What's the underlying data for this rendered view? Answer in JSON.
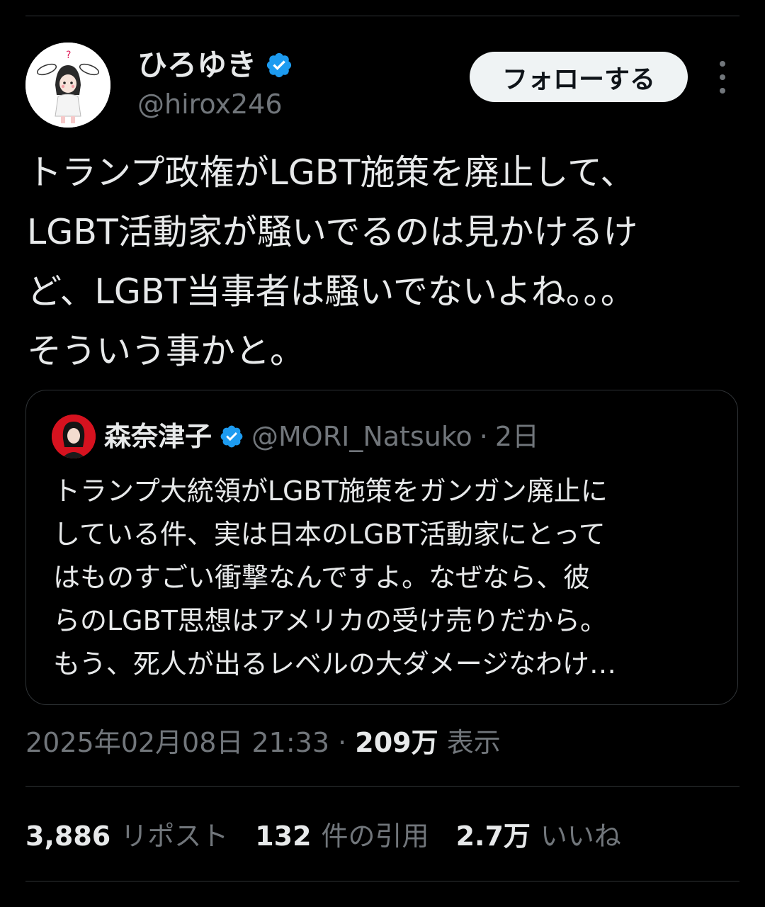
{
  "author": {
    "display_name": "ひろゆき",
    "handle": "@hirox246",
    "verified": true,
    "avatar_icon": "bunny-ears-character-avatar"
  },
  "follow_label": "フォローする",
  "more_icon": "vertical-ellipsis-icon",
  "tweet": {
    "lines": [
      "トランプ政権がLGBT施策を廃止して、",
      "LGBT活動家が騒いでるのは見かけるけ",
      "ど、LGBT当事者は騒いでないよね。。。",
      "そういう事かと。"
    ]
  },
  "quote": {
    "display_name": "森奈津子",
    "handle": "@MORI_Natsuko",
    "separator": "·",
    "time": "2日",
    "verified": true,
    "lines": [
      "トランプ大統領がLGBT施策をガンガン廃止に",
      "している件、実は日本のLGBT活動家にとって",
      "はものすごい衝撃なんですよ。なぜなら、彼",
      "らのLGBT思想はアメリカの受け売りだから。",
      "もう、死人が出るレベルの大ダメージなわけ…"
    ]
  },
  "meta": {
    "timestamp": "2025年02月08日 21:33",
    "separator": "·",
    "views_count": "209万",
    "views_label": "表示"
  },
  "stats": {
    "reposts_count": "3,886",
    "reposts_label": "リポスト",
    "quotes_count": "132",
    "quotes_label": "件の引用",
    "likes_count": "2.7万",
    "likes_label": "いいね"
  },
  "colors": {
    "background": "#000000",
    "text": "#e7e9ea",
    "secondary": "#71767b",
    "verified_blue": "#1d9bf0",
    "border": "#2f3336",
    "follow_bg": "#eff3f4"
  }
}
